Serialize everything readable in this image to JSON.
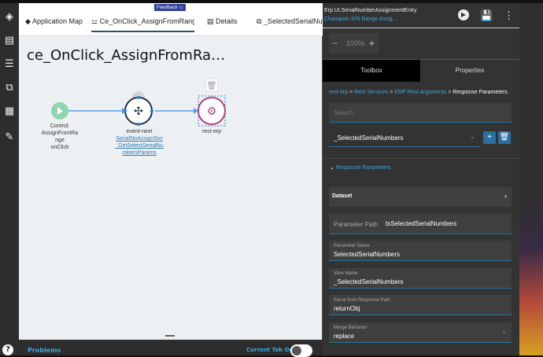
{
  "tabs": [
    {
      "icon": "map-icon",
      "label": "Application Map"
    },
    {
      "icon": "event-icon",
      "label": "Ce_OnClick_AssignFromRang"
    },
    {
      "icon": "details-icon",
      "label": "Details"
    },
    {
      "icon": "dataview-icon",
      "label": "_SelectedSerialNu"
    }
  ],
  "feedback_label": "Feedback",
  "canvas": {
    "title": "ce_OnClick_AssignFromRa…",
    "nodes": [
      {
        "label_lines": [
          "Control:",
          "AssignFromRa",
          "nge",
          "onClick"
        ]
      },
      {
        "label": "event-next",
        "link_lines": [
          "SerialNoAssignSvc",
          "_GetSelectSerialNu",
          "mbersParams"
        ]
      },
      {
        "label": "rest-erp"
      }
    ]
  },
  "bottom": {
    "problems": "Problems",
    "current_tab_only": "Current Tab Only",
    "toggle_on": false
  },
  "panel": {
    "app_name": "Erp.UI.SerialNumberAssignmentEntry",
    "layer_name": "Champion S/N Range Assig…",
    "zoom": "100%",
    "tabs": [
      "Toolbox",
      "Properties"
    ],
    "active_tab": "Properties",
    "breadcrumb": [
      "rest-erp",
      "Rest Services",
      "ERP Rest Arguments",
      "Response Parameters"
    ],
    "search_placeholder": "Search..",
    "selected": "_SelectedSerialNumbers",
    "section": "Response Parameters",
    "dataset": "Dataset",
    "param_path_label": "Parameter Path",
    "param_path": "tsSelectedSerialNumbers",
    "param_name_label": "Parameter Name",
    "param_name": "SelectedSerialNumbers",
    "view_name_label": "View Name",
    "view_name": "_SelectedSerialNumbers",
    "parse_label": "Parse from Response Path",
    "parse": "returnObj",
    "merge_label": "Merge Behavior",
    "merge": "replace"
  },
  "colors": {
    "accent": "#3aa7e0",
    "start_node": "#8fd3b0",
    "rest_node": "#b0407a",
    "panel_bg": "#333333"
  }
}
